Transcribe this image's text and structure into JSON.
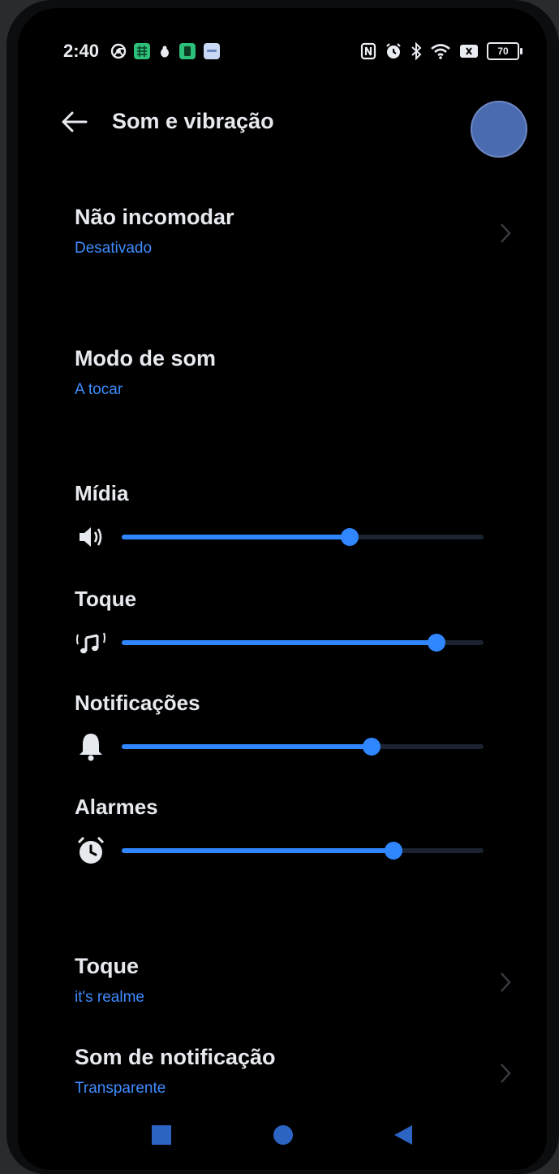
{
  "status_bar": {
    "time": "2:40",
    "battery": "70",
    "left_icons": [
      "chrome-icon",
      "calendar-app-icon",
      "bug-icon",
      "whatsapp-icon",
      "message-icon"
    ],
    "right_icons": [
      "nfc-icon",
      "alarm-icon",
      "bluetooth-icon",
      "wifi-icon",
      "sim-off-icon"
    ]
  },
  "header": {
    "title": "Som e vibração",
    "back_icon": "arrow-left-icon"
  },
  "settings": {
    "dnd": {
      "label": "Não incomodar",
      "value": "Desativado"
    },
    "sound_mode": {
      "label": "Modo de som",
      "value": "A tocar"
    },
    "ringtone": {
      "label": "Toque",
      "value": "it's realme"
    },
    "notification_sound": {
      "label": "Som de notificação",
      "value": "Transparente"
    }
  },
  "volumes": [
    {
      "label": "Mídia",
      "icon": "speaker-icon",
      "level": 0.63
    },
    {
      "label": "Toque",
      "icon": "ringtone-icon",
      "level": 0.87
    },
    {
      "label": "Notificações",
      "icon": "bell-icon",
      "level": 0.69
    },
    {
      "label": "Alarmes",
      "icon": "alarm-clock-icon",
      "level": 0.75
    }
  ],
  "colors": {
    "accent": "#2f86ff",
    "link": "#3f8cff",
    "background": "#000000",
    "text": "#e6e9ee"
  },
  "navbar": [
    "recent-apps-icon",
    "home-icon",
    "back-icon"
  ]
}
